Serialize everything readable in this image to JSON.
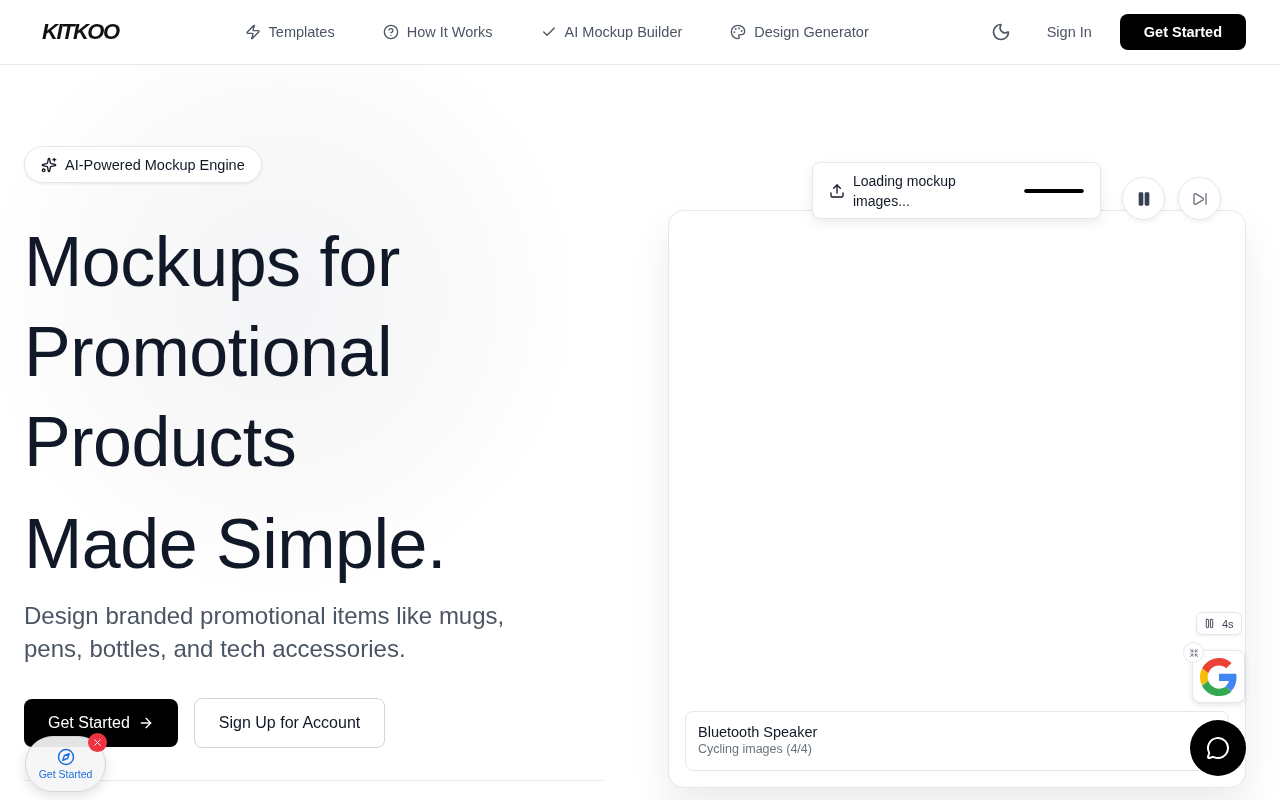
{
  "nav": {
    "logo": "KITKOO",
    "links": [
      {
        "label": "Templates"
      },
      {
        "label": "How It Works"
      },
      {
        "label": "AI Mockup Builder"
      },
      {
        "label": "Design Generator"
      }
    ],
    "sign_in": "Sign In",
    "cta": "Get Started"
  },
  "hero": {
    "badge": "AI-Powered Mockup Engine",
    "headline": [
      "Mockups for",
      "Promotional",
      "Products"
    ],
    "headline_accent": "Made Simple.",
    "subtitle": "Design branded promotional items like mugs, pens, bottles, and tech accessories.",
    "primary_button": "Get Started",
    "secondary_button": "Sign Up for Account"
  },
  "preview": {
    "toast": {
      "text": "Loading mockup images...",
      "level": 1
    },
    "caption": {
      "title": "Bluetooth Speaker",
      "subtitle": "Cycling images (4/4)"
    },
    "timer": "4s"
  },
  "floating_widget": {
    "label": "Get Started"
  }
}
